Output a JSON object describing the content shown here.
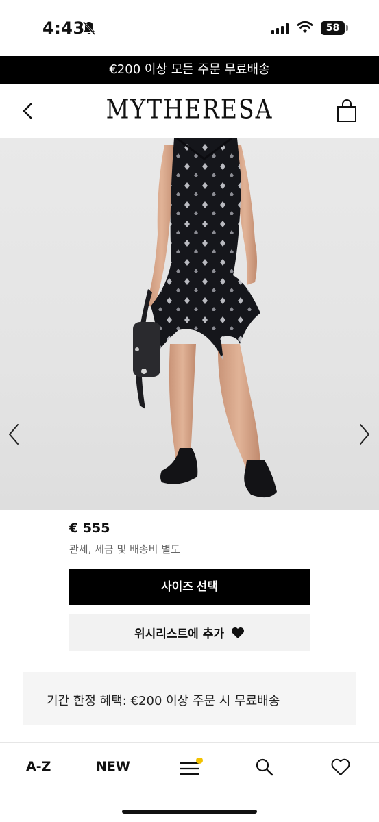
{
  "status_bar": {
    "time": "4:43",
    "battery": "58"
  },
  "promo_banner": {
    "text": "€200 이상 모든 주문 무료배송"
  },
  "header": {
    "brand": "MYTHERESA"
  },
  "product": {
    "price": "€ 555",
    "duty_note": "관세, 세금 및 배송비 별도",
    "size_button_label": "사이즈 선택",
    "wishlist_button_label": "위시리스트에 추가",
    "offer_text": "기간 한정 혜택: €200 이상 주문 시 무료배송"
  },
  "bottom_nav": {
    "az_label": "A-Z",
    "new_label": "NEW"
  },
  "colors": {
    "banner_bg": "#000000",
    "accent_dot": "#f2c200",
    "secondary_button_bg": "#f2f2f2"
  },
  "icons": [
    "bell-off-icon",
    "signal-icon",
    "wifi-icon",
    "battery-icon",
    "back-arrow-icon",
    "shopping-bag-icon",
    "chevron-left-icon",
    "chevron-right-icon",
    "heart-filled-icon",
    "menu-icon",
    "search-icon",
    "heart-outline-icon"
  ]
}
